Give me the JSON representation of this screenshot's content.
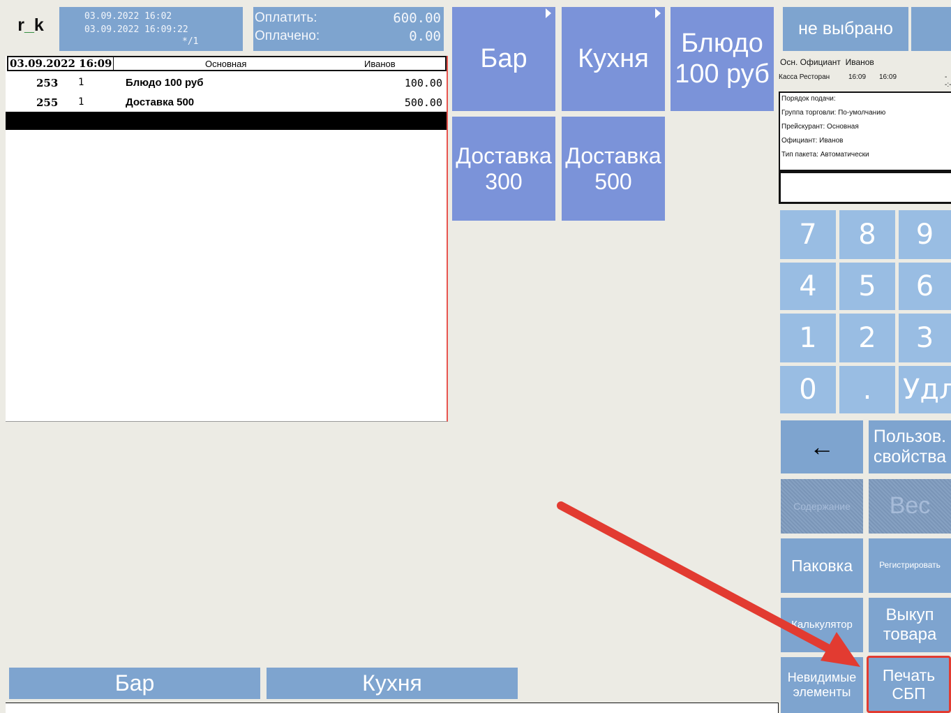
{
  "header": {
    "logo_left": "r",
    "logo_right": "k",
    "date_open": "03.09.2022 16:02",
    "date_now": "03.09.2022 16:09:22",
    "guests": "*/1",
    "to_pay_label": "Оплатить:",
    "to_pay_value": "600.00",
    "paid_label": "Оплачено:",
    "paid_value": "0.00"
  },
  "order": {
    "head_date": "03.09.2022 16:09",
    "head_menu": "Основная",
    "head_waiter": "Иванов",
    "items": [
      {
        "code": "253",
        "qty": "1",
        "name": "Блюдо 100 руб",
        "sum": "100.00"
      },
      {
        "code": "255",
        "qty": "1",
        "name": "Доставка 500",
        "sum": "500.00"
      }
    ]
  },
  "menu": {
    "bar": "Бар",
    "kitchen": "Кухня",
    "dish100_l1": "Блюдо",
    "dish100_l2": "100 руб",
    "delivery300_l1": "Доставка",
    "delivery300_l2": "300",
    "delivery500_l1": "Доставка",
    "delivery500_l2": "500"
  },
  "right": {
    "not_selected": "не выбрано",
    "main_waiter_label": "Осн. Официант",
    "main_waiter": "Иванов",
    "cashbox": "Касса Ресторан",
    "time1": "16:09",
    "time2": "16:09",
    "dash": "--:-",
    "info_lines": [
      "Порядок подачи:",
      "Группа торговли: По-умолчанию",
      "Прейскурант: Основная",
      "Официант: Иванов",
      "Тип пакета: Автоматически"
    ]
  },
  "keypad": [
    "7",
    "8",
    "9",
    "4",
    "5",
    "6",
    "1",
    "2",
    "3",
    "0",
    ".",
    "Удл"
  ],
  "functions": {
    "back_arrow": "←",
    "user_props_l1": "Пользов.",
    "user_props_l2": "свойства",
    "content": "Содержание",
    "weight": "Вес",
    "pack": "Паковка",
    "register": "Регистрировать",
    "calculator": "Калькулятор",
    "buyout_l1": "Выкуп",
    "buyout_l2": "товара",
    "invisible_l1": "Невидимые",
    "invisible_l2": "элементы",
    "print_sbp_l1": "Печать",
    "print_sbp_l2": "СБП"
  },
  "bottom_tabs": [
    "Бар",
    "Кухня"
  ],
  "colors": {
    "tile_menu": "#7b93d9",
    "tile_header": "#7ea4cf",
    "keypad": "#99bde3",
    "highlight": "#e23b31"
  }
}
